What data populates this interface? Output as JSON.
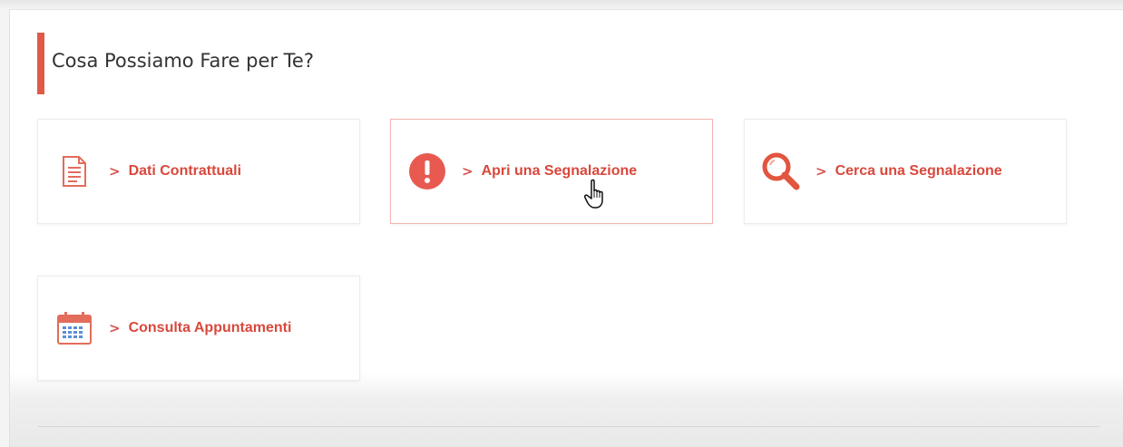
{
  "section": {
    "title": "Cosa Possiamo Fare per Te?"
  },
  "cards": [
    {
      "label": "Dati Contrattuali",
      "icon": "document-icon",
      "chevron": ">"
    },
    {
      "label": "Apri una Segnalazione",
      "icon": "alert-icon",
      "chevron": ">"
    },
    {
      "label": "Cerca una Segnalazione",
      "icon": "search-icon",
      "chevron": ">"
    },
    {
      "label": "Consulta Appuntamenti",
      "icon": "calendar-icon",
      "chevron": ">"
    }
  ],
  "colors": {
    "accent": "#e05a47",
    "label": "#d9483b",
    "active_border": "#f2b5ad"
  }
}
